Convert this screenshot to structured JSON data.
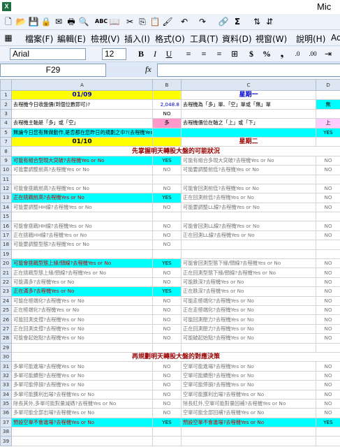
{
  "window": {
    "app_icon": "X",
    "title": "Mic"
  },
  "toolbar_icons": [
    "new-icon",
    "open-icon",
    "save-icon",
    "permission-icon",
    "email-icon",
    "print-icon",
    "preview-icon",
    "spell-icon",
    "research-icon",
    "cut-icon",
    "copy-icon",
    "paste-icon",
    "format-painter-icon",
    "undo-icon",
    "redo-icon",
    "hyperlink-icon",
    "autosum-icon",
    "sort-asc-icon",
    "sort-desc-icon"
  ],
  "menu": [
    "檔案(F)",
    "編輯(E)",
    "檢視(V)",
    "插入(I)",
    "格式(O)",
    "工具(T)",
    "資料(D)",
    "視窗(W)",
    "說明(H)",
    "Ad"
  ],
  "format": {
    "font": "Arial",
    "size": "12",
    "currency": "$",
    "percent": "%"
  },
  "formula": {
    "cell_ref": "F29",
    "fx": "fx",
    "value": ""
  },
  "columns": [
    "A",
    "B",
    "C",
    "D"
  ],
  "rows": [
    {
      "n": "1",
      "a": "01/09",
      "b": "",
      "c": "星期一",
      "d": ""
    },
    {
      "n": "2",
      "a": "去程機今日收盤價(到個位數即可)?",
      "b": "2,048.8",
      "c": "去程機為「多」單、「空」單或「無」單",
      "d": "無"
    },
    {
      "n": "3",
      "a": "",
      "b": "NO",
      "c": "",
      "d": ""
    },
    {
      "n": "4",
      "a": "去程機主軸是「多」或「空」",
      "b": "多",
      "c": "去程機價位在軸之「上」或「下」",
      "d": "上"
    },
    {
      "n": "5",
      "a": "無論今日您有無做動作,是否都在您昨日的規劃之中?(去程機Yes或No)",
      "b": "",
      "c": "",
      "d": "YES"
    },
    {
      "n": "7",
      "a": "01/10",
      "b": "",
      "c": "星期二",
      "d": ""
    },
    {
      "n": "8",
      "a": "先掌握明天轉股大盤的可能狀況",
      "b": "",
      "c": "",
      "d": ""
    },
    {
      "n": "9",
      "a": "可能有組合型現大突破?去程機Yes or No",
      "b": "YES",
      "c": "可能有組合多現大突破?去程機Yes or No",
      "d": "NO"
    },
    {
      "n": "10",
      "a": "可能要調整前高?去程機Yes or No",
      "b": "NO",
      "c": "可能要調整前低?去程機Yes or No",
      "d": "NO"
    },
    {
      "n": "11",
      "a": "",
      "b": "",
      "c": "",
      "d": ""
    },
    {
      "n": "12",
      "a": "可能會挑戰前高?去程機Yes or No",
      "b": "NO",
      "c": "可能會回測前低?去程機Yes or No",
      "d": "NO"
    },
    {
      "n": "13",
      "a": "正在挑戰前高?去程機Yes or No",
      "b": "YES",
      "c": "正在回測前低?去程機Yes or No",
      "d": "NO"
    },
    {
      "n": "14",
      "a": "可能要調整HH線?去程機Yes or No",
      "b": "NO",
      "c": "可能要調整LL線?去程機Yes or No",
      "d": "NO"
    },
    {
      "n": "15",
      "a": "",
      "b": "",
      "c": "",
      "d": ""
    },
    {
      "n": "16",
      "a": "可能會挑戰HH線?去程機Yes or No",
      "b": "NO",
      "c": "可能會回測LL線?去程機Yes or No",
      "d": "NO"
    },
    {
      "n": "17",
      "a": "正在挑戰HH線?去程機Yes or No",
      "b": "NO",
      "c": "正在回測LL線?去程機Yes or No",
      "d": "NO"
    },
    {
      "n": "18",
      "a": "可能要調整型態?去程機Yes or No",
      "b": "NO",
      "c": "",
      "d": ""
    },
    {
      "n": "19",
      "a": "",
      "b": "",
      "c": "",
      "d": ""
    },
    {
      "n": "20",
      "a": "可能會挑戰型態上緣/頸線?去程機Yes or No",
      "b": "YES",
      "c": "可能會回測型態下緣/頸線?去程機Yes or No",
      "d": "NO"
    },
    {
      "n": "21",
      "a": "正在挑戰型態上緣/頸線?去程機Yes or No",
      "b": "NO",
      "c": "正在回測型態下緣/頸線?去程機Yes or No",
      "d": "NO"
    },
    {
      "n": "22",
      "a": "可能滿多?去程機Yes or No",
      "b": "NO",
      "c": "可能跌深?去程機Yes or No",
      "d": "NO"
    },
    {
      "n": "23",
      "a": "正在滿多?去程機Yes or No",
      "b": "YES",
      "c": "正在跌深?去程機Yes or No",
      "d": "NO"
    },
    {
      "n": "24",
      "a": "可能在極端化?去程機Yes or No",
      "b": "NO",
      "c": "可能走極端化?去程機Yes or No",
      "d": "NO"
    },
    {
      "n": "25",
      "a": "正在極端化?去程機Yes or No",
      "b": "NO",
      "c": "正在走極端化?去程機Yes or No",
      "d": "NO"
    },
    {
      "n": "26",
      "a": "可能回測支撐?去程機Yes or No",
      "b": "NO",
      "c": "可能回測壓力?去程機Yes or No",
      "d": "NO"
    },
    {
      "n": "27",
      "a": "正在回測支撐?去程機Yes or No",
      "b": "NO",
      "c": "正在回測壓力?去程機Yes or No",
      "d": "NO"
    },
    {
      "n": "28",
      "a": "可能會起始點?去程機Yes or No",
      "b": "NO",
      "c": "可能破起始點?去程機Yes or No",
      "d": "NO"
    },
    {
      "n": "29",
      "a": "",
      "b": "",
      "c": "",
      "d": ""
    },
    {
      "n": "30",
      "a": "再規劃明天轉股大盤的對應決策",
      "b": "",
      "c": "",
      "d": ""
    },
    {
      "n": "31",
      "a": "多單可能進場?去程機Yes or No",
      "b": "NO",
      "c": "空單可能進場?去程機Yes or No",
      "d": "NO"
    },
    {
      "n": "32",
      "a": "多單可能續抱?去程機Yes or No",
      "b": "NO",
      "c": "空單可能續抱?去程機Yes or No",
      "d": "NO"
    },
    {
      "n": "33",
      "a": "多單可能停損?去程機Yes or No",
      "b": "NO",
      "c": "空單可能停損?去程機Yes or No",
      "d": "NO"
    },
    {
      "n": "34",
      "a": "多單可能獲利出場?去程機Yes or No",
      "b": "NO",
      "c": "空單可能獲利出場?去程機Yes or No",
      "d": "NO"
    },
    {
      "n": "35",
      "a": "除長其外,多單可能對量減碼?去程機Yes or No",
      "b": "NO",
      "c": "除長紅外,空單可能對量回補?去程機Yes or No",
      "d": "NO"
    },
    {
      "n": "36",
      "a": "多單可能全部出場?去程機Yes or No",
      "b": "NO",
      "c": "空單可能全部回補?去程機Yes or No",
      "d": "NO"
    },
    {
      "n": "37",
      "a": "預設空單不會進場?去程機Yes or No",
      "b": "YES",
      "c": "預設空單不會進場?去程機Yes or No",
      "d": "YES"
    },
    {
      "n": "38",
      "a": "",
      "b": "",
      "c": "",
      "d": ""
    },
    {
      "n": "39",
      "a": "",
      "b": "",
      "c": "",
      "d": ""
    }
  ]
}
